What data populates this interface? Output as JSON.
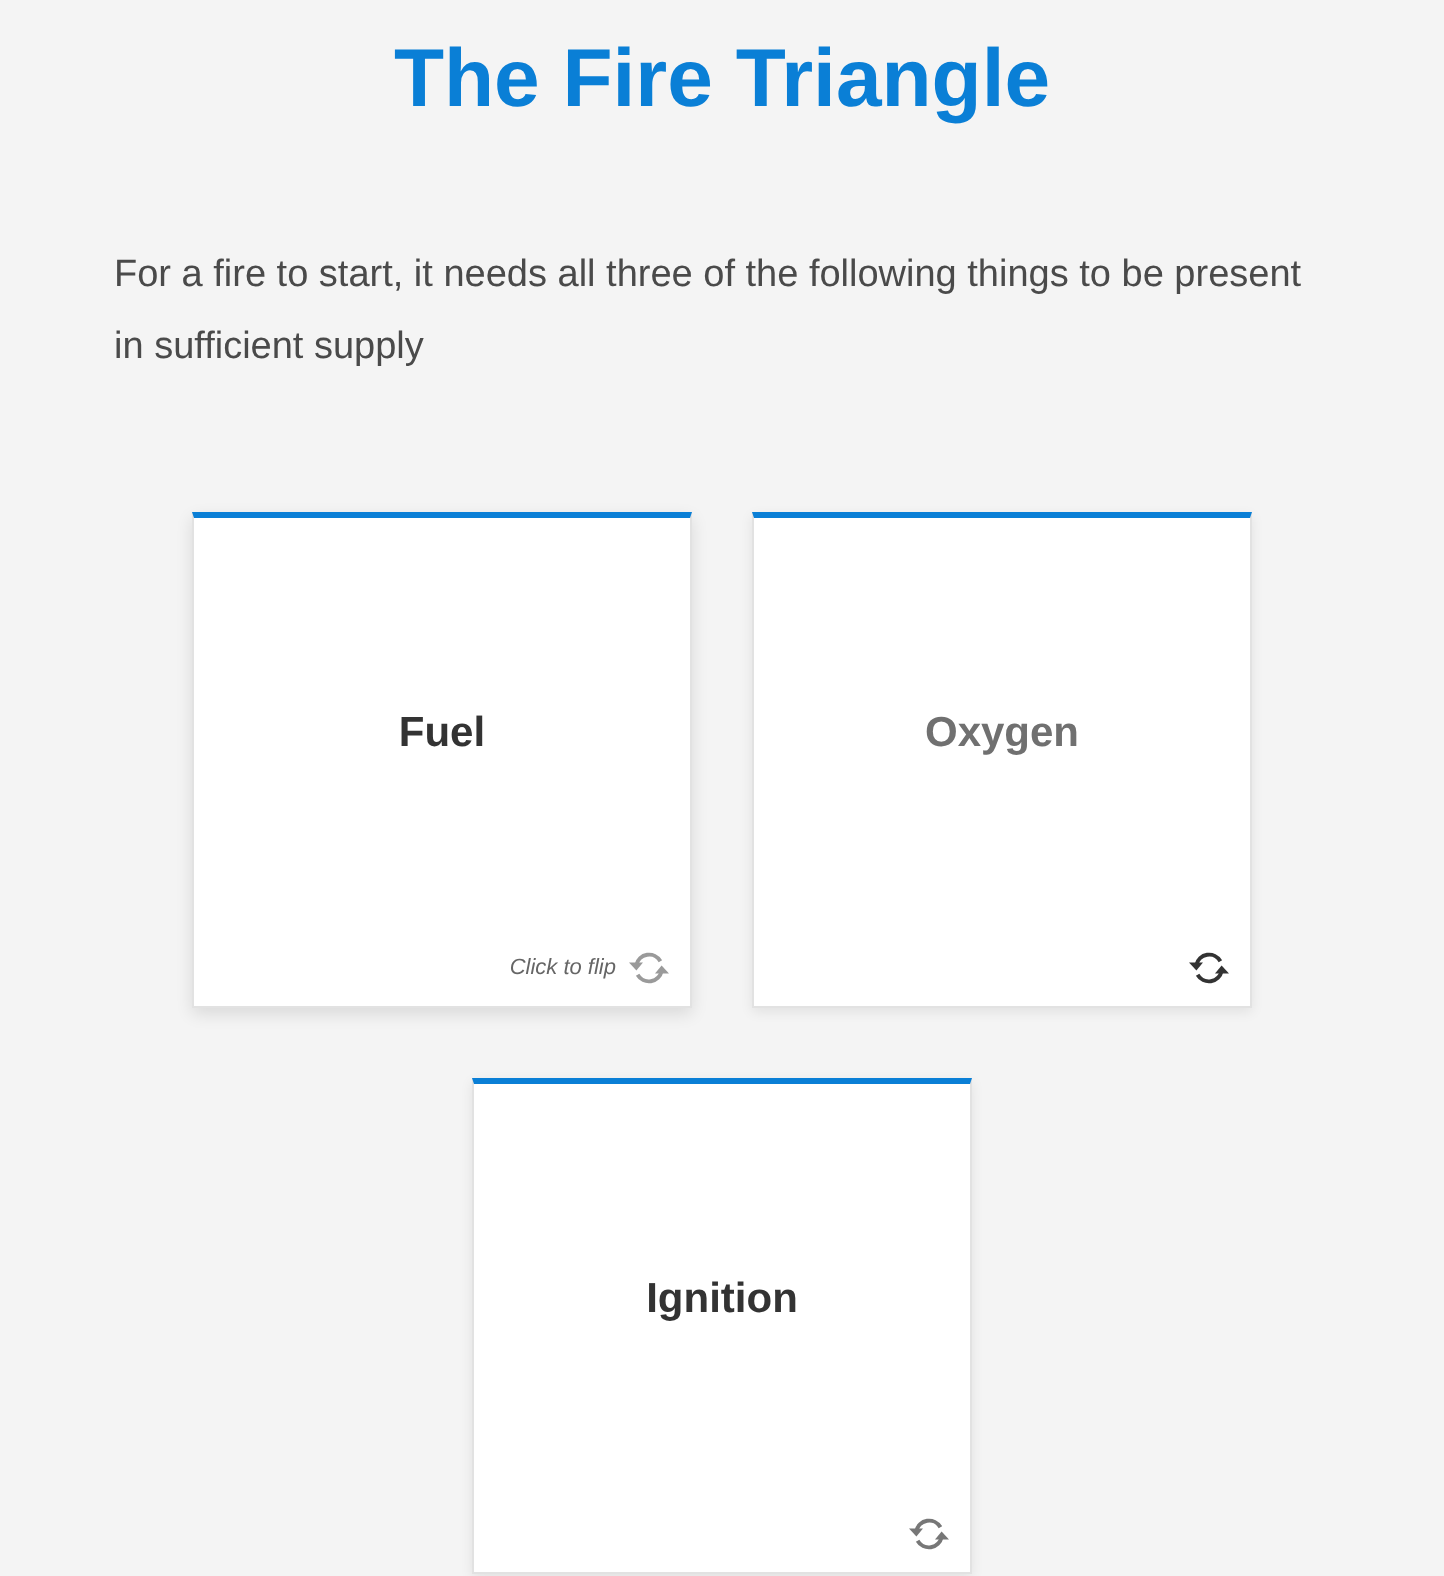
{
  "page": {
    "title": "The Fire Triangle",
    "intro": "For a fire to start, it needs all three of the following things to be present in sufficient supply"
  },
  "cards": [
    {
      "title": "Fuel",
      "dimmed": false,
      "hovered": true,
      "hint": "Click to flip",
      "icon_active": false
    },
    {
      "title": "Oxygen",
      "dimmed": true,
      "hovered": false,
      "icon_active": true
    },
    {
      "title": "Ignition",
      "dimmed": false,
      "hovered": false,
      "icon_active": false
    }
  ]
}
